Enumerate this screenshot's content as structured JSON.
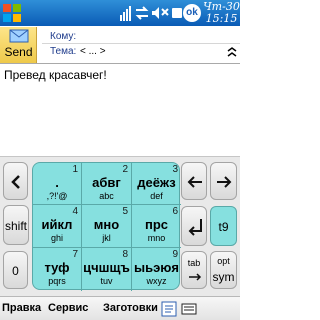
{
  "statusbar": {
    "day": "Чт-30",
    "time": "15:15",
    "ok": "ok"
  },
  "compose": {
    "send_label": "Send",
    "to_label": "Кому:",
    "subject_label": "Тема:",
    "subject_value": "< ... >",
    "body_text": "Превед красавчег!"
  },
  "keyboard": {
    "keys": [
      {
        "num": "1",
        "letters": ".",
        "latin": ",?!'@"
      },
      {
        "num": "2",
        "letters": "абвг",
        "latin": "abc"
      },
      {
        "num": "3",
        "letters": "деёжз",
        "latin": "def"
      },
      {
        "num": "4",
        "letters": "ийкл",
        "latin": "ghi"
      },
      {
        "num": "5",
        "letters": "мно",
        "latin": "jkl"
      },
      {
        "num": "6",
        "letters": "прс",
        "latin": "mno"
      },
      {
        "num": "7",
        "letters": "туф",
        "latin": "pqrs"
      },
      {
        "num": "8",
        "letters": "цчшщъ",
        "latin": "tuv"
      },
      {
        "num": "9",
        "letters": "ыьэюя",
        "latin": "wxyz"
      }
    ],
    "side_keys": {
      "shift": "shift",
      "t9": "t9",
      "zero": "0",
      "tab": "tab",
      "opt_sym_top": "opt",
      "opt_sym_bottom": "sym"
    }
  },
  "menubar": {
    "items": [
      "Правка",
      "Сервис",
      "Заготовки"
    ]
  }
}
